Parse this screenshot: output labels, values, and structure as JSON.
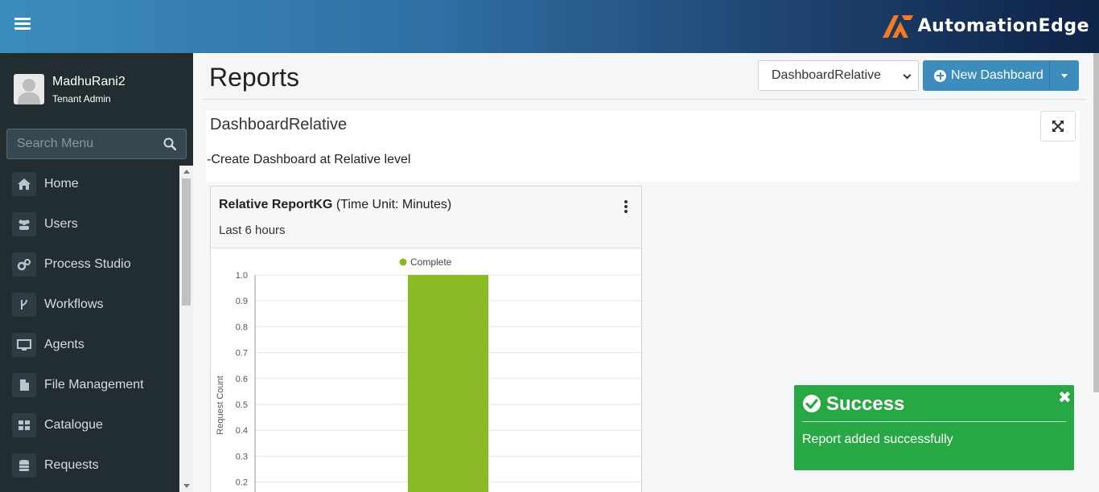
{
  "brand": {
    "name": "AutomationEdge"
  },
  "user": {
    "name": "MadhuRani2",
    "role": "Tenant Admin"
  },
  "sidebar": {
    "search_placeholder": "Search Menu",
    "items": [
      {
        "label": "Home",
        "icon": "home-icon"
      },
      {
        "label": "Users",
        "icon": "users-icon"
      },
      {
        "label": "Process Studio",
        "icon": "gears-icon"
      },
      {
        "label": "Workflows",
        "icon": "workflow-icon"
      },
      {
        "label": "Agents",
        "icon": "monitor-icon"
      },
      {
        "label": "File Management",
        "icon": "file-icon"
      },
      {
        "label": "Catalogue",
        "icon": "grid-icon"
      },
      {
        "label": "Requests",
        "icon": "database-icon"
      }
    ]
  },
  "page": {
    "title": "Reports",
    "dashboard_select": "DashboardRelative",
    "new_dashboard_label": "New Dashboard"
  },
  "dashboard": {
    "name": "DashboardRelative",
    "description": "-Create Dashboard at Relative level"
  },
  "report": {
    "title_bold": "Relative ReportKG",
    "title_rest": " (Time Unit: Minutes)",
    "subtitle": "Last 6 hours"
  },
  "chart_data": {
    "type": "bar",
    "series": [
      {
        "name": "Complete",
        "values": [
          1.0
        ]
      }
    ],
    "categories": [
      ""
    ],
    "ylabel": "Request Count",
    "ylim": [
      0,
      1.0
    ],
    "yticks": [
      "1.0",
      "0.9",
      "0.8",
      "0.7",
      "0.6",
      "0.5",
      "0.4",
      "0.3",
      "0.2"
    ],
    "legend": "top-center",
    "colors": {
      "Complete": "#8aba24"
    },
    "grid": true
  },
  "toast": {
    "title": "Success",
    "message": "Report added successfully",
    "color": "#28a745"
  }
}
